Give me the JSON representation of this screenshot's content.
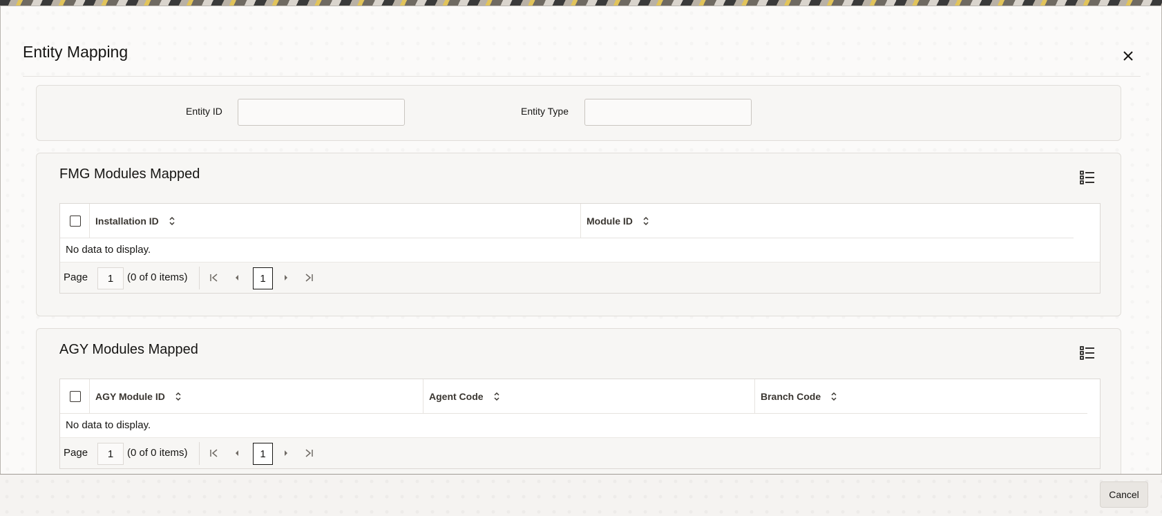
{
  "dialog": {
    "title": "Entity Mapping",
    "close_icon": "close-icon"
  },
  "filters": {
    "entity_id_label": "Entity ID",
    "entity_id_value": "",
    "entity_type_label": "Entity Type",
    "entity_type_value": ""
  },
  "fmg": {
    "title": "FMG Modules Mapped",
    "columns": [
      "Installation ID",
      "Module ID"
    ],
    "rows": [],
    "empty_text": "No data to display.",
    "pager": {
      "page_label": "Page",
      "page": "1",
      "count": "(0 of 0 items)",
      "current": "1"
    }
  },
  "agy": {
    "title": "AGY Modules Mapped",
    "columns": [
      "AGY Module ID",
      "Agent Code",
      "Branch Code"
    ],
    "rows": [],
    "empty_text": "No data to display.",
    "pager": {
      "page_label": "Page",
      "page": "1",
      "count": "(0 of 0 items)",
      "current": "1"
    }
  },
  "footer": {
    "cancel_label": "Cancel"
  }
}
